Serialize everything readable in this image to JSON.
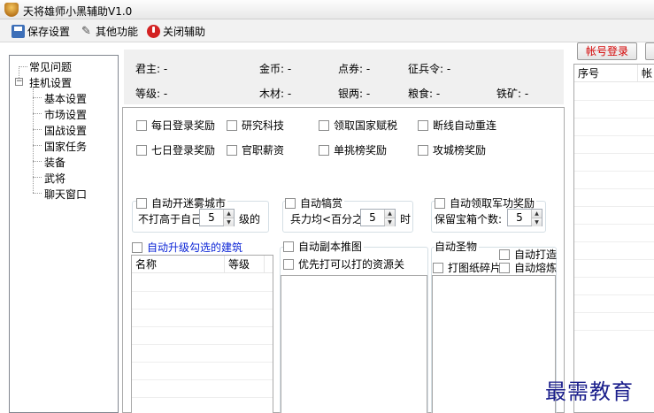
{
  "window": {
    "title": "天将雄师小黑辅助V1.0"
  },
  "toolbar": {
    "save_label": "保存设置",
    "other_label": "其他功能",
    "close_label": "关闭辅助"
  },
  "nav": {
    "faq": "常见问题",
    "hangup": "挂机设置",
    "toggle": "−",
    "children": [
      "基本设置",
      "市场设置",
      "国战设置",
      "国家任务",
      "装备",
      "武将",
      "聊天窗口"
    ]
  },
  "stats": {
    "lord": "君主: -",
    "gold": "金币: -",
    "coupon": "点券: -",
    "conscript": "征兵令: -",
    "level": "等级: -",
    "wood": "木材: -",
    "silver": "银两: -",
    "food": "粮食: -",
    "iron": "铁矿: -"
  },
  "checks": {
    "daily_login": "每日登录奖励",
    "research": "研究科技",
    "collect_tax": "领取国家赋税",
    "reconnect": "断线自动重连",
    "seven_day": "七日登录奖励",
    "salary": "官职薪资",
    "challenge_rank": "单挑榜奖励",
    "siege_rank": "攻城榜奖励"
  },
  "fog": {
    "title": "自动开迷雾城市",
    "prefix": "不打高于自己",
    "value": "5",
    "suffix": "级的"
  },
  "reward": {
    "title": "自动犒赏",
    "prefix": "兵力均<百分之",
    "value": "5",
    "suffix": "时"
  },
  "merit": {
    "title": "自动领取军功奖励",
    "prefix": "保留宝箱个数:",
    "value": "5"
  },
  "building": {
    "title": "自动升级勾选的建筑",
    "col_name": "名称",
    "col_level": "等级"
  },
  "dungeon": {
    "title": "自动副本推图",
    "priority": "优先打可以打的资源关"
  },
  "relic": {
    "title": "自动圣物",
    "forge": "自动打造",
    "fragments": "打图纸碎片",
    "smelt": "自动熔炼"
  },
  "account": {
    "login_label": "帐号登录",
    "col_no": "序号",
    "col_partial": "帐"
  },
  "watermark": "最需教育",
  "colors": {
    "accent_red": "#d40000",
    "link_blue": "#0b24d6",
    "panel_bg": "#f0f0f0"
  }
}
